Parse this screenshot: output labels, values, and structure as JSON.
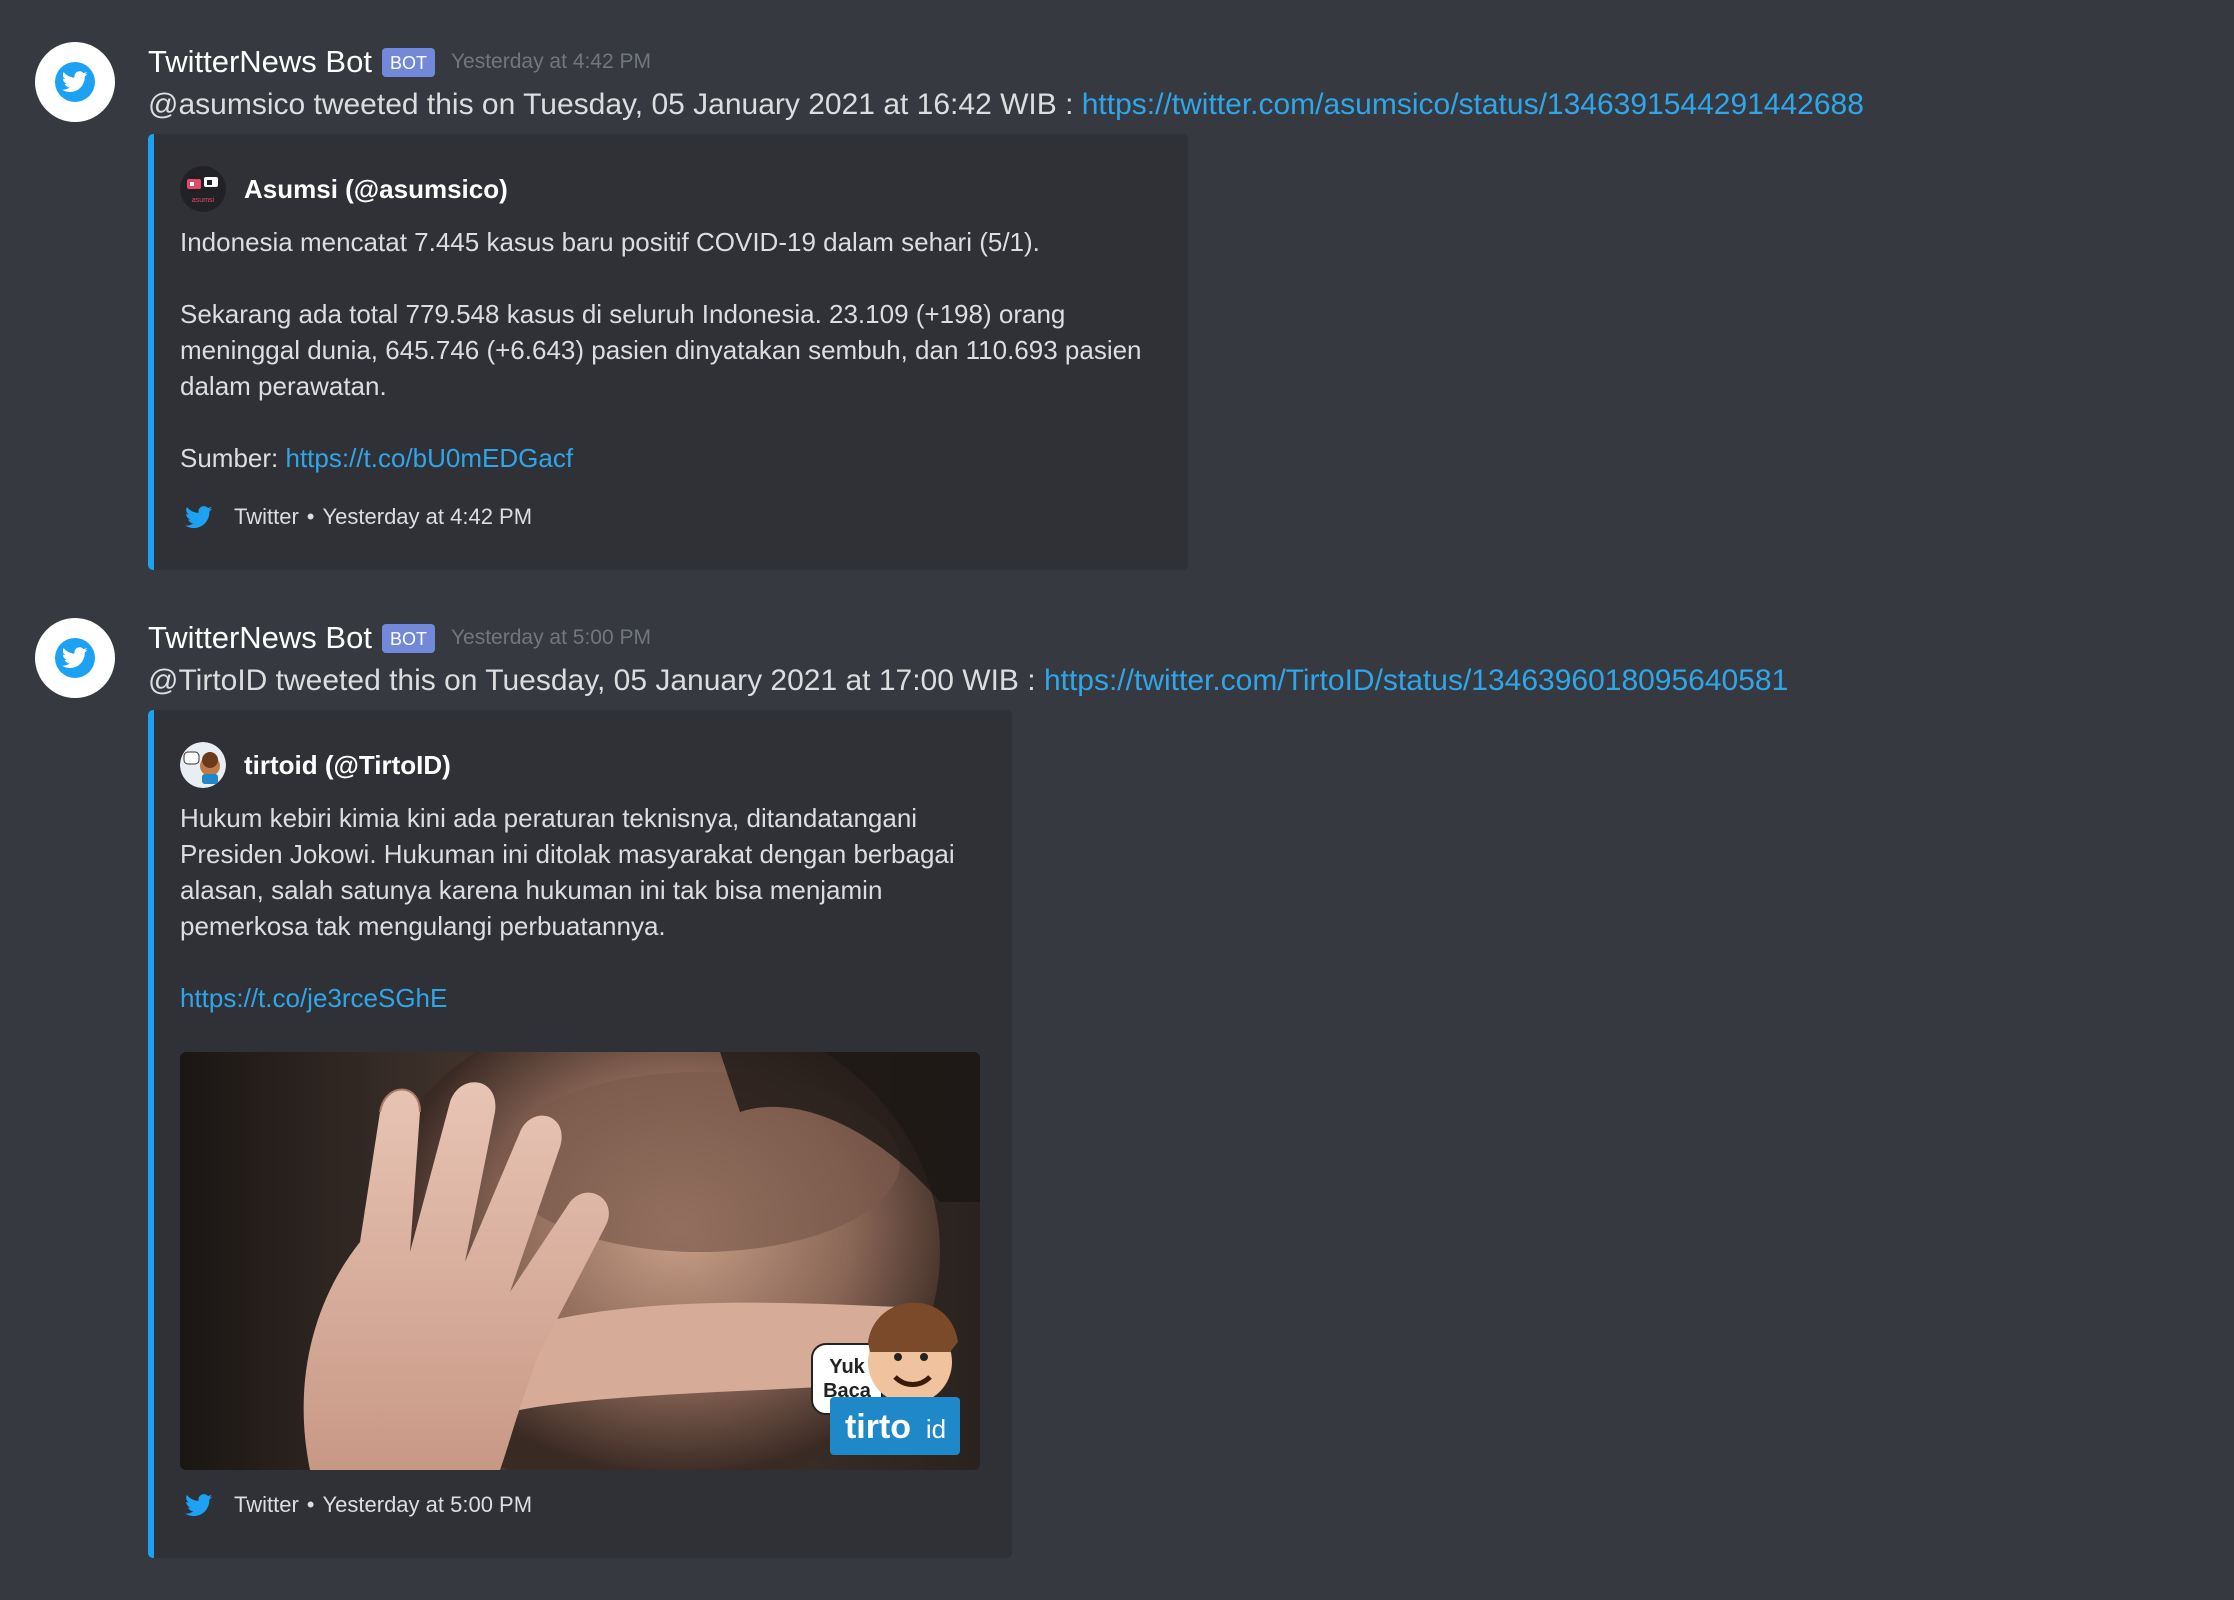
{
  "messages": [
    {
      "author": "TwitterNews Bot",
      "bot_tag": "BOT",
      "timestamp": "Yesterday at 4:42 PM",
      "content_text": "@asumsico tweeted this on Tuesday, 05 January 2021 at 16:42 WIB : ",
      "content_link": "https://twitter.com/asumsico/status/1346391544291442688",
      "embed": {
        "author": "Asumsi (@asumsico)",
        "desc_line1": "Indonesia mencatat 7.445 kasus baru positif COVID-19 dalam sehari (5/1).",
        "desc_line2": "Sekarang ada total 779.548 kasus di seluruh Indonesia. 23.109 (+198) orang meninggal dunia, 645.746 (+6.643) pasien dinyatakan sembuh, dan 110.693 pasien dalam perawatan.",
        "source_label": "Sumber: ",
        "source_link": "https://t.co/bU0mEDGacf",
        "footer_source": "Twitter",
        "footer_separator": "•",
        "footer_time": "Yesterday at 4:42 PM",
        "icon_label": "asumsi"
      }
    },
    {
      "author": "TwitterNews Bot",
      "bot_tag": "BOT",
      "timestamp": "Yesterday at 5:00 PM",
      "content_text": "@TirtoID tweeted this on Tuesday, 05 January 2021 at 17:00 WIB : ",
      "content_link": "https://twitter.com/TirtoID/status/1346396018095640581",
      "embed": {
        "author": "tirtoid (@TirtoID)",
        "desc_line1": "Hukum kebiri kimia kini ada peraturan teknisnya, ditandatangani Presiden Jokowi. Hukuman ini ditolak masyarakat dengan berbagai alasan, salah satunya karena hukuman ini tak bisa menjamin pemerkosa tak mengulangi perbuatannya.",
        "desc_link": "https://t.co/je3rceSGhE",
        "image_bubble_line1": "Yuk",
        "image_bubble_line2": "Baca",
        "image_logo": "tirto",
        "image_logo_suffix": "id",
        "footer_source": "Twitter",
        "footer_separator": "•",
        "footer_time": "Yesterday at 5:00 PM"
      }
    }
  ],
  "colors": {
    "background": "#36393f",
    "embed_bg": "#2f3136",
    "embed_border": "#1da1f2",
    "link": "#2fa6ea",
    "bot_tag": "#7289da"
  },
  "icons": {
    "avatar": "twitter-bird-icon",
    "footer": "twitter-bird-icon"
  }
}
